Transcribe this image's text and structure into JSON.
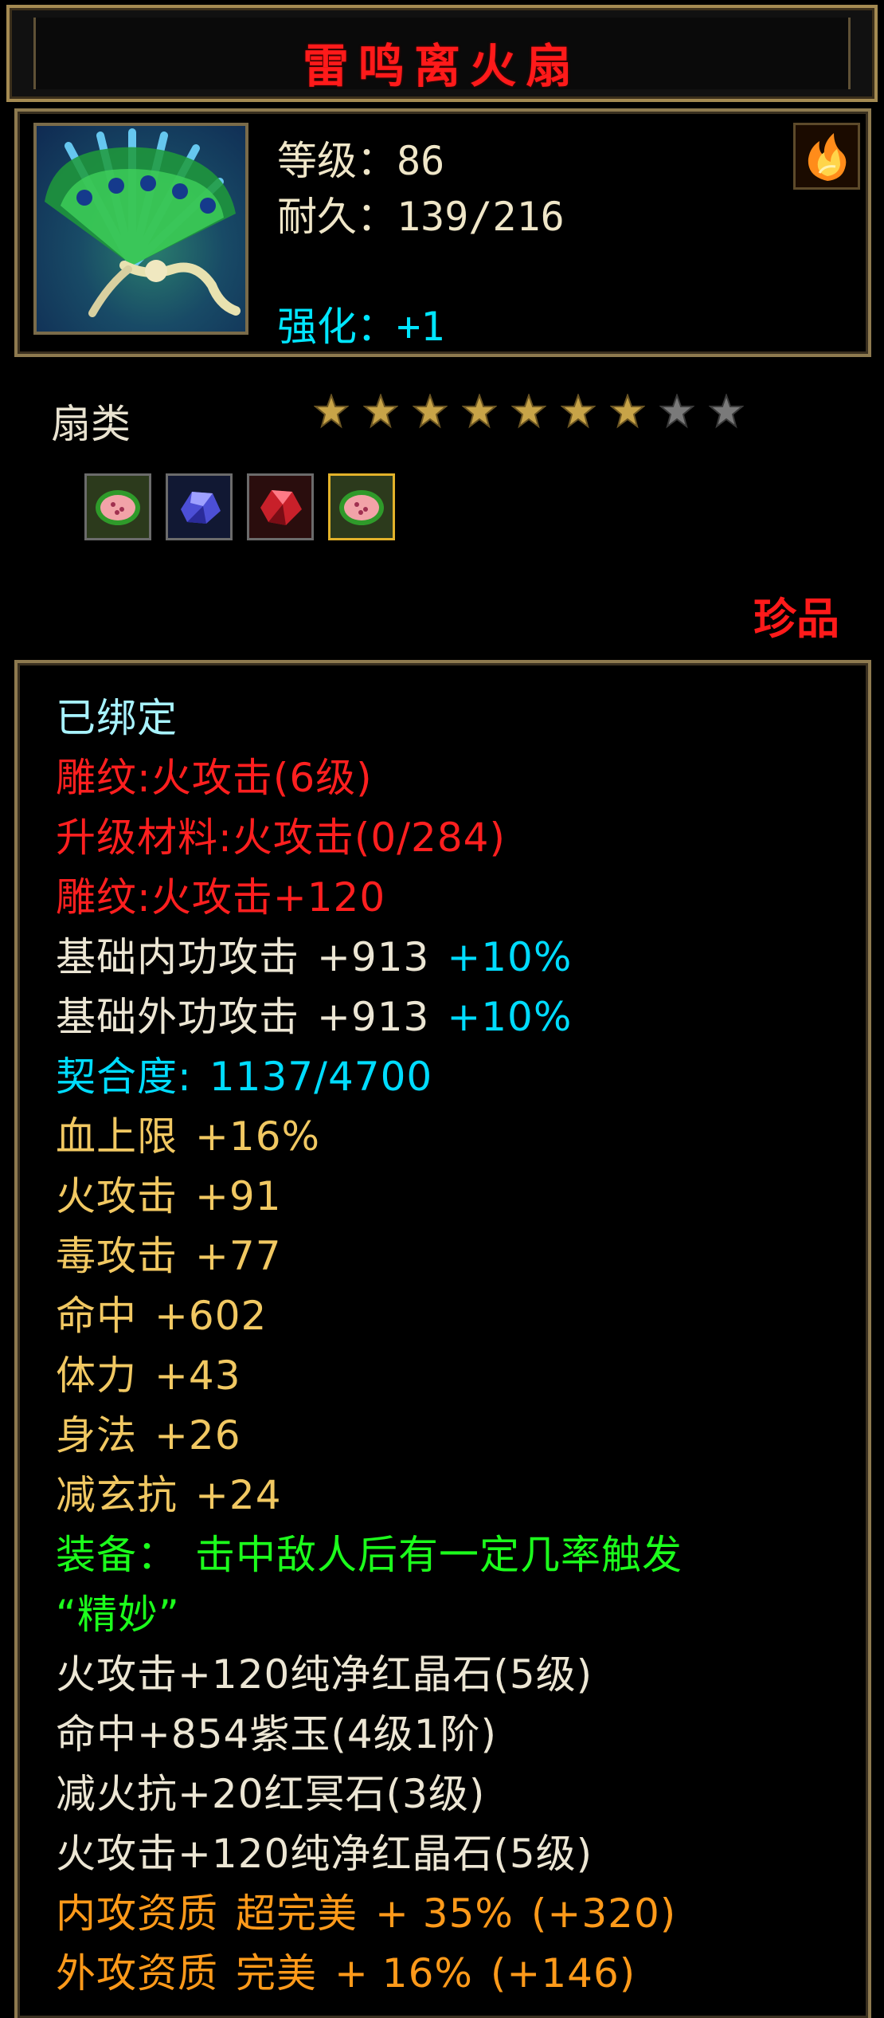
{
  "item": {
    "name": "雷鸣离火扇",
    "level_label": "等级：86",
    "durability_label": "耐久：139/216",
    "enhance_label": "强化：+1",
    "category": "扇类",
    "rarity": "珍品",
    "stars": {
      "filled": 7,
      "total": 9
    },
    "icons": {
      "item": "feathered-fan-icon",
      "element": "fire-element-icon"
    },
    "gem_slots": [
      {
        "icon": "watermelon-gem-icon",
        "selected": false
      },
      {
        "icon": "blue-crystal-icon",
        "selected": false
      },
      {
        "icon": "red-ruby-icon",
        "selected": false
      },
      {
        "icon": "watermelon-gem-icon",
        "selected": true
      }
    ]
  },
  "attributes": {
    "bound": "已绑定",
    "engrave_level": "雕纹:火攻击(6级)",
    "upgrade_material": "升级材料:火攻击(0/284)",
    "engrave_bonus": "雕纹:火攻击+120",
    "inner_attack": {
      "label": "基础内功攻击",
      "value": "+913",
      "bonus": "+10%"
    },
    "outer_attack": {
      "label": "基础外功攻击",
      "value": "+913",
      "bonus": "+10%"
    },
    "affinity": {
      "label": "契合度:",
      "value": "1137/4700"
    },
    "hp_limit": {
      "label": "血上限",
      "value": "+16%"
    },
    "fire_attack": {
      "label": "火攻击",
      "value": "+91"
    },
    "poison_attack": {
      "label": "毒攻击",
      "value": "+77"
    },
    "hit": {
      "label": "命中",
      "value": "+602"
    },
    "stamina": {
      "label": "体力",
      "value": "+43"
    },
    "agility": {
      "label": "身法",
      "value": "+26"
    },
    "reduce_mystic_res": {
      "label": "减玄抗",
      "value": "+24"
    },
    "equip_effect": {
      "label": "装备：",
      "text": "击中敌人后有一定几率触发",
      "name": "“精妙”"
    },
    "gems": [
      "火攻击+120纯净红晶石(5级)",
      "命中+854紫玉(4级1阶)",
      "减火抗+20红冥石(3级)",
      "火攻击+120纯净红晶石(5级)"
    ],
    "inner_quality": {
      "label": "内攻资质",
      "grade": "超完美",
      "percent": "+ 35%",
      "value": "(+320)"
    },
    "outer_quality": {
      "label": "外攻资质",
      "grade": "完美",
      "percent": "+ 16%",
      "value": "(+146)"
    }
  },
  "colors": {
    "title": "#ff1a1a",
    "frame": "#8e7a4f",
    "red_text": "#ff1f1f",
    "cyan_text": "#00dcff",
    "yellow_text": "#f1c862",
    "green_text": "#1cff1c",
    "orange_text": "#ff9a1a",
    "star_filled": "#c8a448",
    "star_empty": "#7a7a7a"
  }
}
